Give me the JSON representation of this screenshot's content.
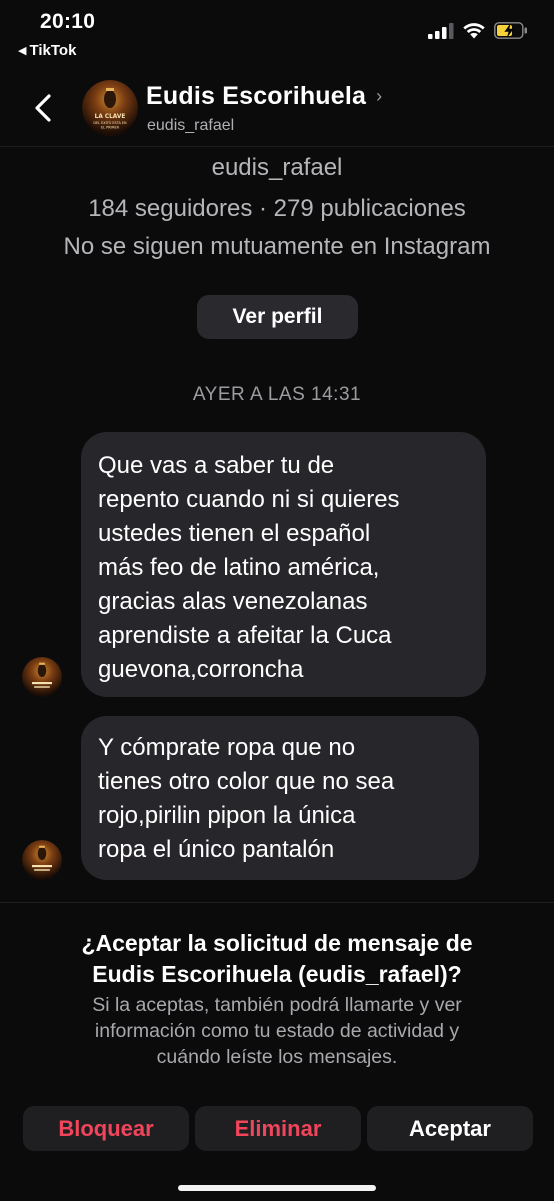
{
  "status_bar": {
    "time": "20:10",
    "back_app": "TikTok",
    "icons": [
      "signal-icon",
      "wifi-icon",
      "battery-charging-icon"
    ],
    "battery_color": "#f5d23a"
  },
  "header": {
    "name": "Eudis Escorihuela",
    "username": "eudis_rafael",
    "avatar_text": [
      "LA CLAVE",
      "DEL EXITO ESTA EN",
      "EL PRIMER"
    ]
  },
  "profile": {
    "username": "eudis_rafael",
    "stats": "184 seguidores · 279 publicaciones",
    "mutual": "No se siguen mutuamente en Instagram",
    "view_profile_label": "Ver perfil"
  },
  "conversation": {
    "timestamp": "AYER A LAS 14:31",
    "messages": [
      {
        "lines": [
          "Que vas a saber tu de",
          "repento cuando ni si quieres",
          "ustedes tienen el español",
          "más feo de latino américa,",
          "gracias alas venezolanas",
          "aprendiste a afeitar la Cuca",
          "guevona,corroncha"
        ]
      },
      {
        "lines": [
          "Y cómprate ropa que no",
          "tienes otro color que no sea",
          "rojo,pirilin pipon la única",
          "ropa el único pantalón"
        ]
      }
    ]
  },
  "request": {
    "title_line1": "¿Aceptar la solicitud de mensaje de",
    "title_line2": "Eudis Escorihuela (eudis_rafael)?",
    "body_line1": "Si la aceptas, también podrá llamarte y ver",
    "body_line2": "información como tu estado de actividad y",
    "body_line3": "cuándo leíste los mensajes.",
    "block_label": "Bloquear",
    "delete_label": "Eliminar",
    "accept_label": "Aceptar",
    "danger_color": "#f0455a"
  }
}
